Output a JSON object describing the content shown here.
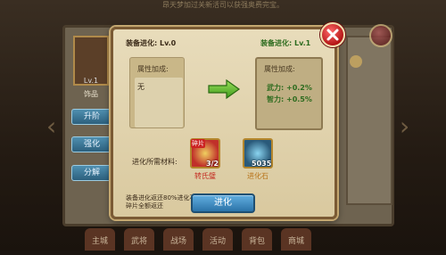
{
  "top_banner": "昂天梦加过关新活司以获强奥费完宝。",
  "background": {
    "item_level": "Lv.1",
    "item_category": "饰品",
    "side_buttons": [
      "升阶",
      "强化",
      "分解"
    ],
    "bottom_nav": [
      "主城",
      "武将",
      "战场",
      "活动",
      "背包",
      "商城"
    ]
  },
  "dialog": {
    "left_level": "装备进化: Lv.0",
    "right_level": "装备进化: Lv.1",
    "left_attr_title": "属性加成:",
    "left_attr_value": "无",
    "right_attr_title": "属性加成:",
    "stats": [
      {
        "label": "武力:",
        "value": "+0.2%"
      },
      {
        "label": "智力:",
        "value": "+0.5%"
      }
    ],
    "materials_label": "进化所需材料:",
    "materials": [
      {
        "tag": "碎片",
        "count": "3/2",
        "name": "转氏璧"
      },
      {
        "count": "5035",
        "name": "进化石"
      }
    ],
    "note": "装备进化返还80%进化石碎片全额返还",
    "evolve_button": "进化"
  },
  "colors": {
    "accent_green": "#2c6b1e",
    "button_blue": "#2b73a8",
    "close_red": "#b41616"
  }
}
